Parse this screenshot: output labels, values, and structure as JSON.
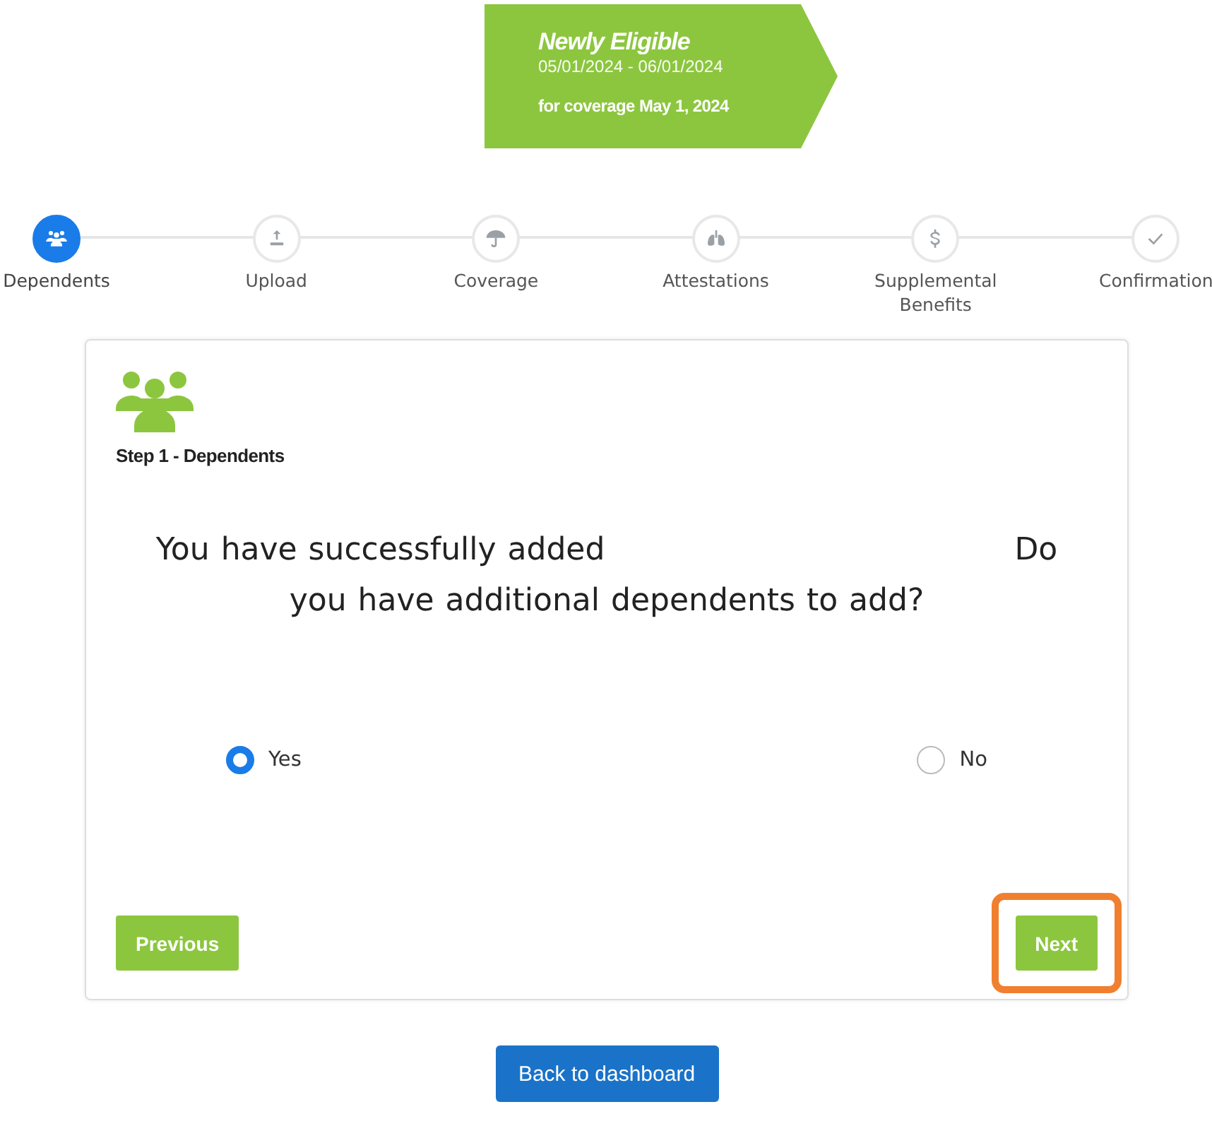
{
  "banner": {
    "title": "Newly Eligible",
    "dates": "05/01/2024 - 06/01/2024",
    "coverage": "for coverage May 1, 2024"
  },
  "steps": [
    {
      "label": "Dependents",
      "kind": "people",
      "selected": true
    },
    {
      "label": "Upload",
      "kind": "upload",
      "selected": false
    },
    {
      "label": "Coverage",
      "kind": "umbrella",
      "selected": false
    },
    {
      "label": "Attestations",
      "kind": "lungs",
      "selected": false
    },
    {
      "label": "Supplemental Benefits",
      "kind": "dollar",
      "selected": false
    },
    {
      "label": "Confirmation",
      "kind": "check",
      "selected": false
    }
  ],
  "card": {
    "step_title": "Step 1 - Dependents",
    "question_start": "You have successfully added",
    "question_end": "Do you have additional dependents to add?",
    "options": [
      {
        "label": "Yes",
        "selected": true
      },
      {
        "label": "No",
        "selected": false
      }
    ],
    "buttons": [
      {
        "label": "Previous",
        "highlighted": false
      },
      {
        "label": "Next",
        "highlighted": true
      }
    ]
  },
  "footer_button": "Back to dashboard"
}
